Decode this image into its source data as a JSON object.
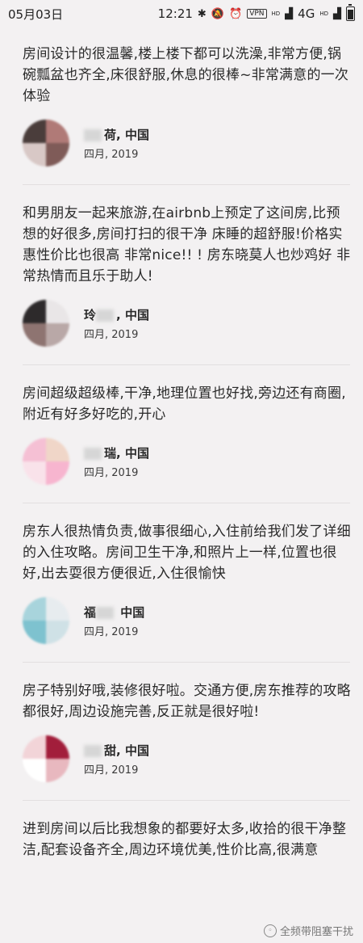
{
  "status_bar": {
    "date": "05月03日",
    "time": "12:21",
    "vpn": "VPN",
    "network": "4G",
    "hd": "HD"
  },
  "reviews": [
    {
      "text": "房间设计的很温馨,楼上楼下都可以洗澡,非常方便,锅碗瓢盆也齐全,床很舒服,休息的很棒~非常满意的一次体验",
      "name_visible": "荷",
      "location": "中国",
      "date": "四月, 2019",
      "avatar_colors": [
        "#4a3d3b",
        "#b07a77",
        "#d8c8c6",
        "#7f5b58"
      ]
    },
    {
      "text": "和男朋友一起来旅游,在airbnb上预定了这间房,比预想的好很多,房间打扫的很干净 床睡的超舒服!价格实惠性价比也很高 非常nice!! ! 房东晓莫人也炒鸡好 非常热情而且乐于助人!",
      "name_visible": "玲",
      "location": "中国",
      "date": "四月, 2019",
      "avatar_colors": [
        "#2d2a2b",
        "#e9e6e7",
        "#8e7471",
        "#b9a8a7"
      ]
    },
    {
      "text": "房间超级超级棒,干净,地理位置也好找,旁边还有商圈,附近有好多好吃的,开心",
      "name_visible": "瑞",
      "location": "中国",
      "date": "四月, 2019",
      "avatar_colors": [
        "#f5c0d4",
        "#f0d6c8",
        "#f9e2ea",
        "#f7b5cf"
      ]
    },
    {
      "text": "房东人很热情负责,做事很细心,入住前给我们发了详细的入住攻略。房间卫生干净,和照片上一样,位置也很好,出去耍很方便很近,入住很愉快",
      "name_visible": "福",
      "location": "中国",
      "date": "四月, 2019",
      "avatar_colors": [
        "#a8d4dc",
        "#e7ecef",
        "#7ec2cf",
        "#cfe1e6"
      ]
    },
    {
      "text": "房子特别好哦,装修很好啦。交通方便,房东推荐的攻略都很好,周边设施完善,反正就是很好啦!",
      "name_visible": "甜",
      "location": "中国",
      "date": "四月, 2019",
      "avatar_colors": [
        "#f2d4d8",
        "#a21e3b",
        "#ffffff",
        "#e8b8bf"
      ]
    },
    {
      "text": "进到房间以后比我想象的都要好太多,收拾的很干净整洁,配套设备齐全,周边环境优美,性价比高,很满意"
    }
  ],
  "watermark": {
    "text": "全频带阻塞干扰"
  }
}
